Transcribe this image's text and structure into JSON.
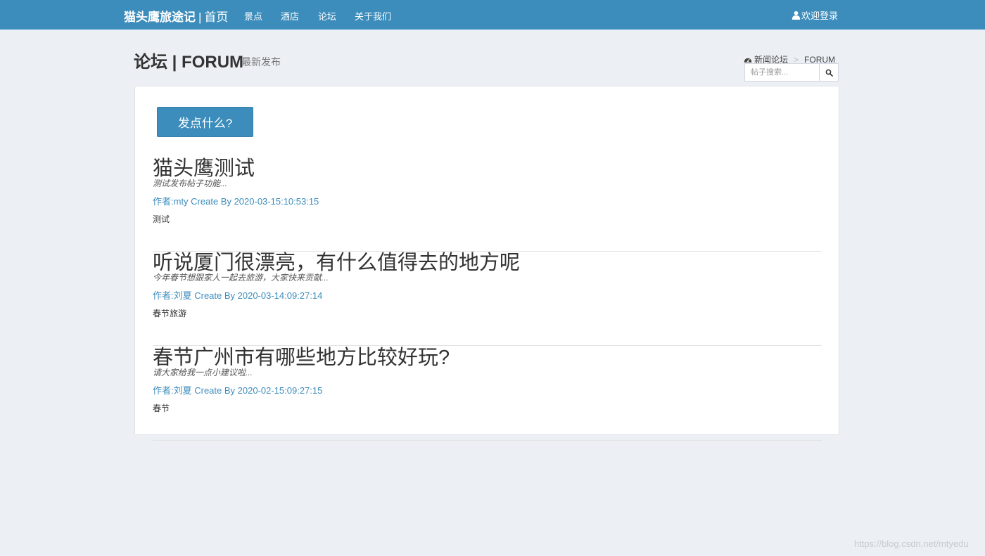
{
  "navbar": {
    "brand": "猫头鹰旅途记",
    "separator": "|",
    "home": "首页",
    "links": [
      "景点",
      "酒店",
      "论坛",
      "关于我们"
    ],
    "login": "欢迎登录"
  },
  "header": {
    "title": "论坛 | FORUM",
    "subtitle": "最新发布",
    "breadcrumb": [
      "新闻论坛",
      "FORUM"
    ],
    "search_placeholder": "帖子搜索..."
  },
  "main": {
    "post_button": "发点什么?",
    "posts": [
      {
        "title": "猫头鹰测试",
        "summary": "测试发布帖子功能...",
        "meta": "作者:mty Create By 2020-03-15:10:53:15",
        "tag": "测试"
      },
      {
        "title": "听说厦门很漂亮，有什么值得去的地方呢",
        "summary": "今年春节想跟家人一起去旅游，大家快来贡献...",
        "meta": "作者:刘夏 Create By 2020-03-14:09:27:14",
        "tag": "春节旅游"
      },
      {
        "title": "春节广州市有哪些地方比较好玩?",
        "summary": "请大家给我一点小建议啦...",
        "meta": "作者:刘夏 Create By 2020-02-15:09:27:15",
        "tag": "春节"
      }
    ]
  },
  "watermark": "https://blog.csdn.net/mtyedu",
  "colors": {
    "primary": "#3c8dbc",
    "background": "#ecf0f5"
  },
  "icons": {
    "login": "user-icon",
    "breadcrumb": "dashboard-icon",
    "search": "search-icon"
  }
}
